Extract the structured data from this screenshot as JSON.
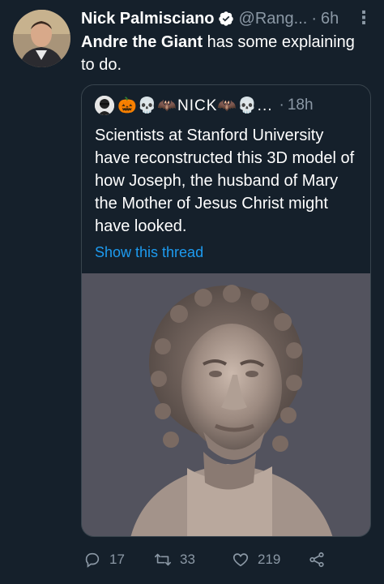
{
  "tweet": {
    "author_name": "Nick Palmisciano",
    "handle": "@Rang...",
    "separator": "·",
    "time": "6h",
    "more_icon": "more-vertical-icon",
    "text_mention": "Andre the Giant",
    "text_rest": " has some explaining to do."
  },
  "quote": {
    "author_name": "🎃💀🦇NICK🦇💀...",
    "separator": "·",
    "time": "18h",
    "text": "Scientists at Stanford University have reconstructed this 3D model of how Joseph, the husband of Mary the Mother of Jesus Christ might have looked.",
    "show_thread": "Show this thread"
  },
  "actions": {
    "reply_count": "17",
    "retweet_count": "33",
    "like_count": "219"
  },
  "colors": {
    "background": "#15202b",
    "secondary_text": "#8b98a5",
    "link": "#1d9bf0",
    "border": "#38444d"
  }
}
